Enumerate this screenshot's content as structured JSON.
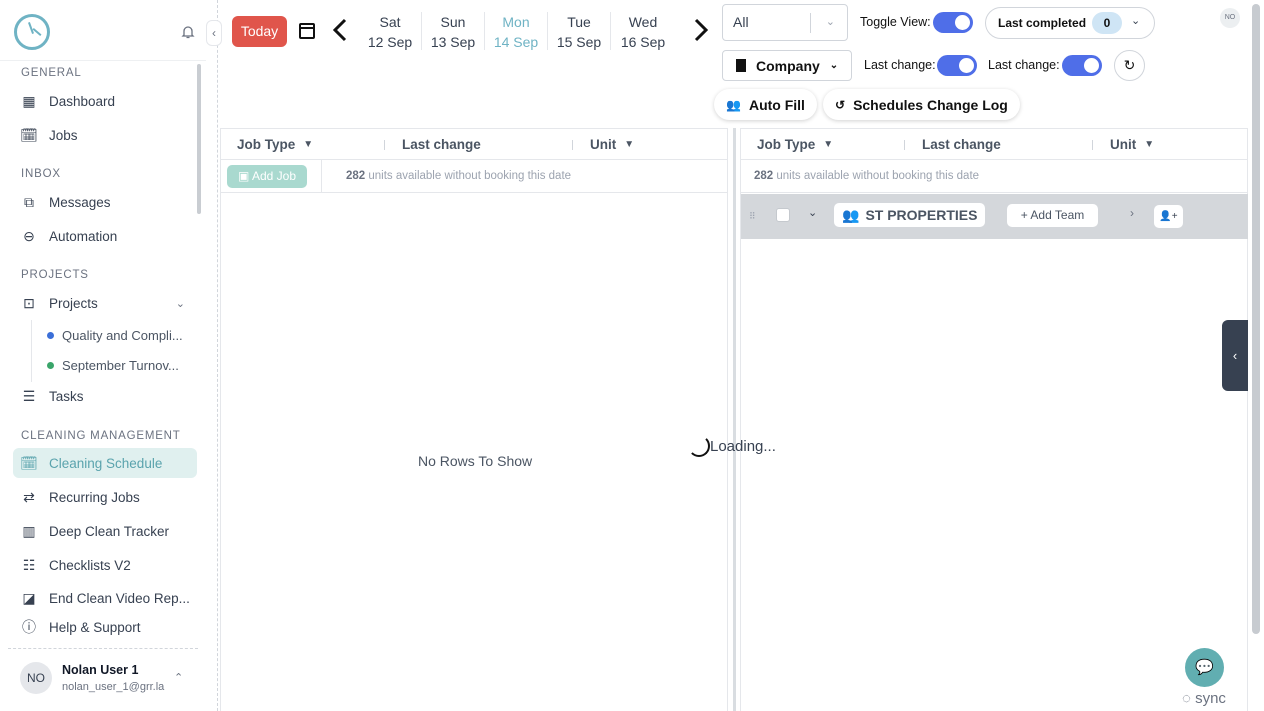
{
  "sidebar": {
    "collapse_icon": "‹",
    "sections": {
      "general": "GENERAL",
      "inbox": "INBOX",
      "projects": "PROJECTS",
      "cleaning": "CLEANING MANAGEMENT"
    },
    "items": {
      "dashboard": "Dashboard",
      "jobs": "Jobs",
      "messages": "Messages",
      "automation": "Automation",
      "projects": "Projects",
      "project_1": "Quality and Compli...",
      "project_2": "September Turnov...",
      "tasks": "Tasks",
      "cleaning_schedule": "Cleaning Schedule",
      "recurring_jobs": "Recurring Jobs",
      "deep_clean": "Deep Clean Tracker",
      "checklists": "Checklists V2",
      "end_clean": "End Clean Video Rep...",
      "help": "Help & Support"
    },
    "project_colors": [
      "#3b6fd8",
      "#3aa56a"
    ],
    "active_color": "#5aa3ad",
    "user": {
      "initials": "NO",
      "name": "Nolan User 1",
      "email": "nolan_user_1@grr.la"
    }
  },
  "topbar": {
    "today": "Today",
    "prev": "‹",
    "next": "›",
    "days": [
      {
        "dow": "Sat",
        "date": "12 Sep"
      },
      {
        "dow": "Sun",
        "date": "13 Sep"
      },
      {
        "dow": "Mon",
        "date": "14 Sep"
      },
      {
        "dow": "Tue",
        "date": "15 Sep"
      },
      {
        "dow": "Wed",
        "date": "16 Sep"
      }
    ],
    "filter_value": "All",
    "toggle_view": "Toggle View:",
    "last_completed": "Last completed",
    "last_completed_count": "0",
    "avatar_initials": "NO",
    "company": "Company",
    "last_change_1": "Last change:",
    "last_change_2": "Last change:",
    "auto_fill": "Auto Fill",
    "change_log": "Schedules Change Log",
    "accent": "#e0554b",
    "toggle_color": "#4f6ee8"
  },
  "left_panel": {
    "col_job_type": "Job Type",
    "col_last_change": "Last change",
    "col_unit": "Unit",
    "add_job": "Add Job",
    "units_count": "282",
    "units_text": " units available without booking this date",
    "empty": "No Rows To Show"
  },
  "right_panel": {
    "col_job_type": "Job Type",
    "col_last_change": "Last change",
    "col_unit": "Unit",
    "units_count": "282",
    "units_text": " units available without booking this date",
    "team_name": "ST PROPERTIES",
    "add_team": "+  Add Team"
  },
  "loading": "Loading...",
  "side_tab_icon": "‹",
  "sync": "sync"
}
